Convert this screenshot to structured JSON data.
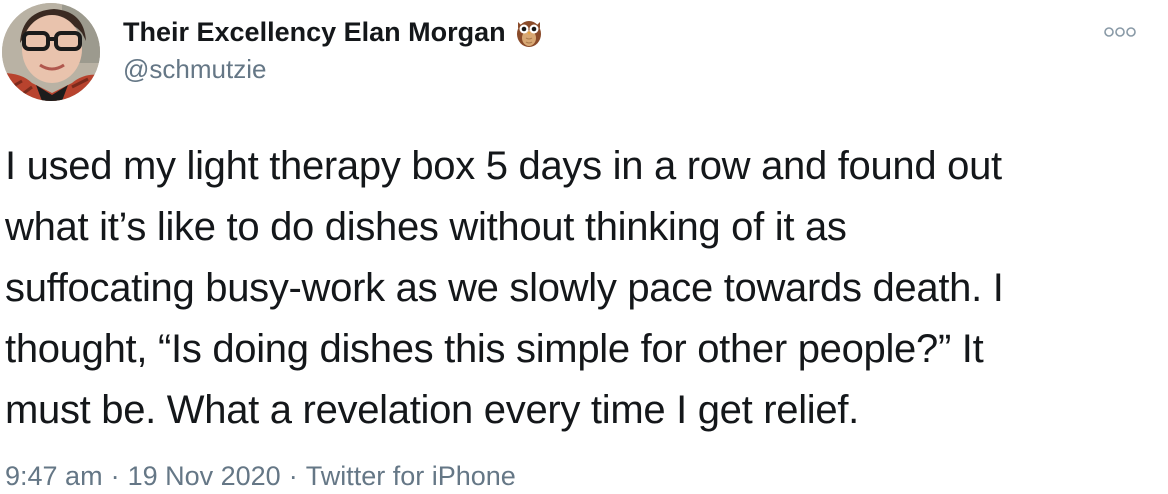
{
  "author": {
    "display_name": "Their Excellency Elan Morgan",
    "name_emoji": "owl-icon",
    "handle": "@schmutzie"
  },
  "tweet": {
    "lines": [
      "I used my light therapy box 5 days in a row and found out",
      "what it’s like to do dishes without thinking of it as",
      "suffocating busy-work as we slowly pace towards death. I",
      "thought, “Is doing dishes this simple for other people?” It",
      "must be. What a revelation every time I get relief."
    ]
  },
  "meta": {
    "time": "9:47 am",
    "separator": "·",
    "date": "19 Nov 2020",
    "source": "Twitter for iPhone"
  },
  "actions": {
    "more_icon": "more-options-icon"
  },
  "colors": {
    "text": "#14171a",
    "secondary": "#657786"
  }
}
